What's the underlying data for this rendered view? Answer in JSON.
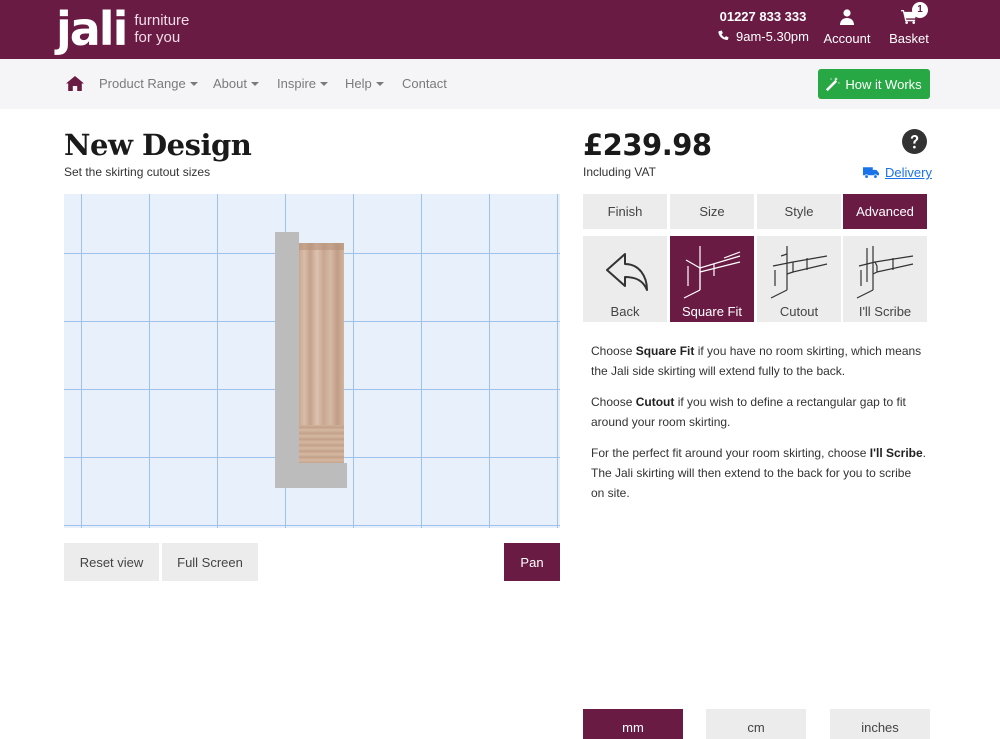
{
  "header": {
    "logo_mark": "jali",
    "logo_tag_line1": "furniture",
    "logo_tag_line2": "for you",
    "phone": "01227 833 333",
    "hours": "9am-5.30pm",
    "account_label": "Account",
    "basket_label": "Basket",
    "basket_count": "1",
    "brand_color": "#6a1b44"
  },
  "nav": {
    "home_icon": "home-icon",
    "items": [
      {
        "label": "Product Range",
        "dropdown": true
      },
      {
        "label": "About",
        "dropdown": true
      },
      {
        "label": "Inspire",
        "dropdown": true
      },
      {
        "label": "Help",
        "dropdown": true
      },
      {
        "label": "Contact",
        "dropdown": false
      }
    ],
    "how_it_works": "How it Works",
    "how_color": "#28a745"
  },
  "design": {
    "title": "New Design",
    "subtitle": "Set the skirting cutout sizes",
    "reset_view": "Reset view",
    "full_screen": "Full Screen",
    "pan": "Pan"
  },
  "pricing": {
    "price": "£239.98",
    "vat_note": "Including VAT",
    "delivery": "Delivery"
  },
  "tabs": [
    {
      "label": "Finish",
      "active": false
    },
    {
      "label": "Size",
      "active": false
    },
    {
      "label": "Style",
      "active": false
    },
    {
      "label": "Advanced",
      "active": true
    }
  ],
  "options": [
    {
      "label": "Back",
      "icon": "back-arrow-icon",
      "active": false
    },
    {
      "label": "Square Fit",
      "icon": "square-fit-icon",
      "active": true
    },
    {
      "label": "Cutout",
      "icon": "cutout-icon",
      "active": false
    },
    {
      "label": "I'll Scribe",
      "icon": "scribe-icon",
      "active": false
    }
  ],
  "help": {
    "p1_pre": "Choose ",
    "p1_bold": "Square Fit",
    "p1_post": " if you have no room skirting, which means the Jali side skirting will extend fully to the back.",
    "p2_pre": "Choose ",
    "p2_bold": "Cutout",
    "p2_post": " if you wish to define a rectangular gap to fit around your room skirting.",
    "p3_pre": "For the perfect fit around your room skirting, choose ",
    "p3_bold": "I'll Scribe",
    "p3_post": ". The Jali skirting will then extend to the back for you to scribe on site."
  },
  "units": [
    {
      "label": "mm",
      "active": true
    },
    {
      "label": "cm",
      "active": false
    },
    {
      "label": "inches",
      "active": false
    }
  ]
}
